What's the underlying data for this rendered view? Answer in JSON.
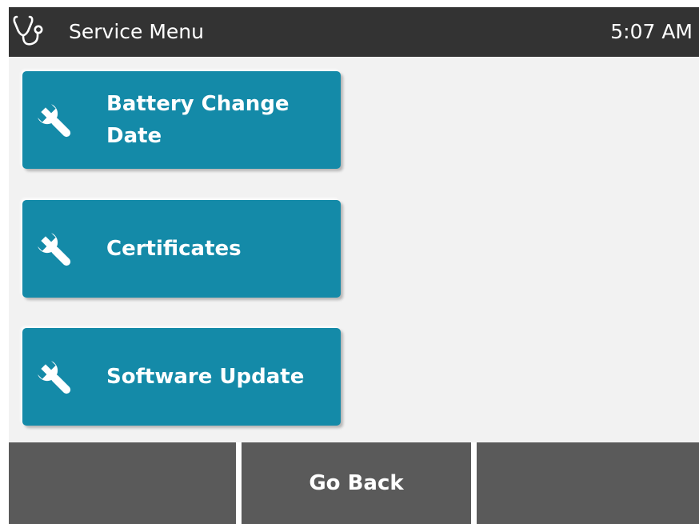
{
  "header": {
    "title": "Service Menu",
    "time": "5:07 AM",
    "icon": "stethoscope-icon"
  },
  "menu": {
    "items": [
      {
        "label": "Battery Change Date",
        "icon": "wrench-icon"
      },
      {
        "label": "Certificates",
        "icon": "wrench-icon"
      },
      {
        "label": "Software Update",
        "icon": "wrench-icon"
      }
    ]
  },
  "softkeys": {
    "left": "",
    "center": "Go Back",
    "right": ""
  },
  "colors": {
    "header_bg": "#333333",
    "button_bg": "#148aa8",
    "softkey_bg": "#5a5a5a",
    "screen_bg": "#f2f2f2"
  }
}
